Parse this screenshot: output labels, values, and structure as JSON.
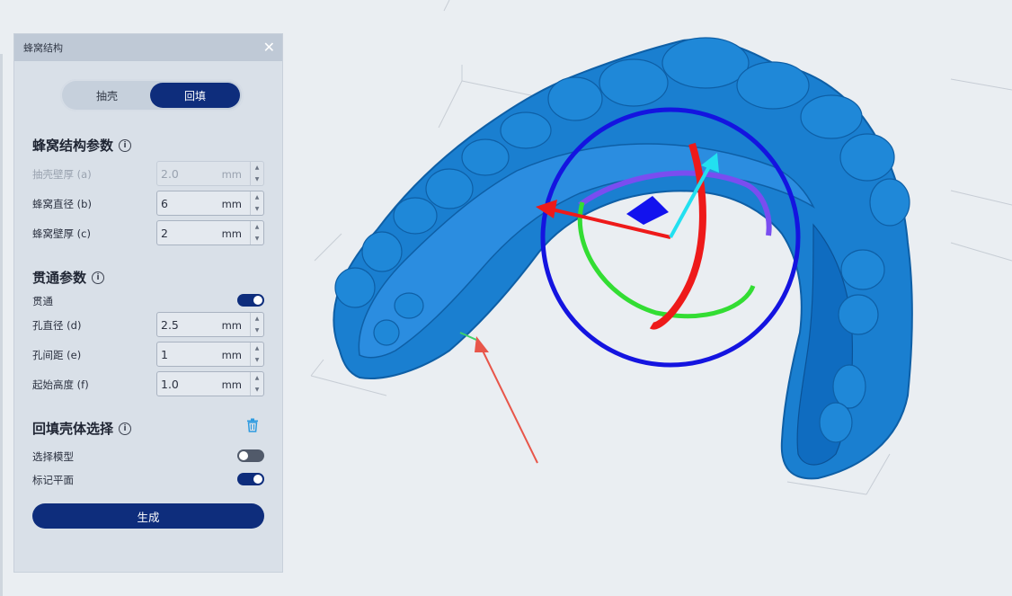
{
  "panel": {
    "title": "蜂窝结构",
    "close": "✕",
    "mode_tabs": [
      "抽壳",
      "回填"
    ],
    "active_tab": "回填"
  },
  "honeycomb": {
    "title": "蜂窝结构参数",
    "shell_thickness": {
      "label": "抽壳壁厚 (a)",
      "value": "2.0",
      "unit": "mm",
      "disabled": true
    },
    "cell_diameter": {
      "label": "蜂窝直径 (b)",
      "value": "6",
      "unit": "mm"
    },
    "cell_wall": {
      "label": "蜂窝壁厚 (c)",
      "value": "2",
      "unit": "mm"
    }
  },
  "through": {
    "title": "贯通参数",
    "toggle_label": "贯通",
    "toggle_on": true,
    "hole_diameter": {
      "label": "孔直径 (d)",
      "value": "2.5",
      "unit": "mm"
    },
    "hole_spacing": {
      "label": "孔间距 (e)",
      "value": "1",
      "unit": "mm"
    },
    "start_height": {
      "label": "起始高度 (f)",
      "value": "1.0",
      "unit": "mm"
    }
  },
  "backfill": {
    "title": "回填壳体选择",
    "select_model": {
      "label": "选择模型",
      "on": false
    },
    "mark_plane": {
      "label": "标记平面",
      "on": true
    }
  },
  "generate_label": "生成",
  "icons": [
    "info-icon",
    "trash-icon",
    "close-icon"
  ],
  "colors": {
    "accent": "#0e2d7c",
    "model_blue": "#1a7fd0",
    "panel_bg": "#d9e0e8"
  }
}
